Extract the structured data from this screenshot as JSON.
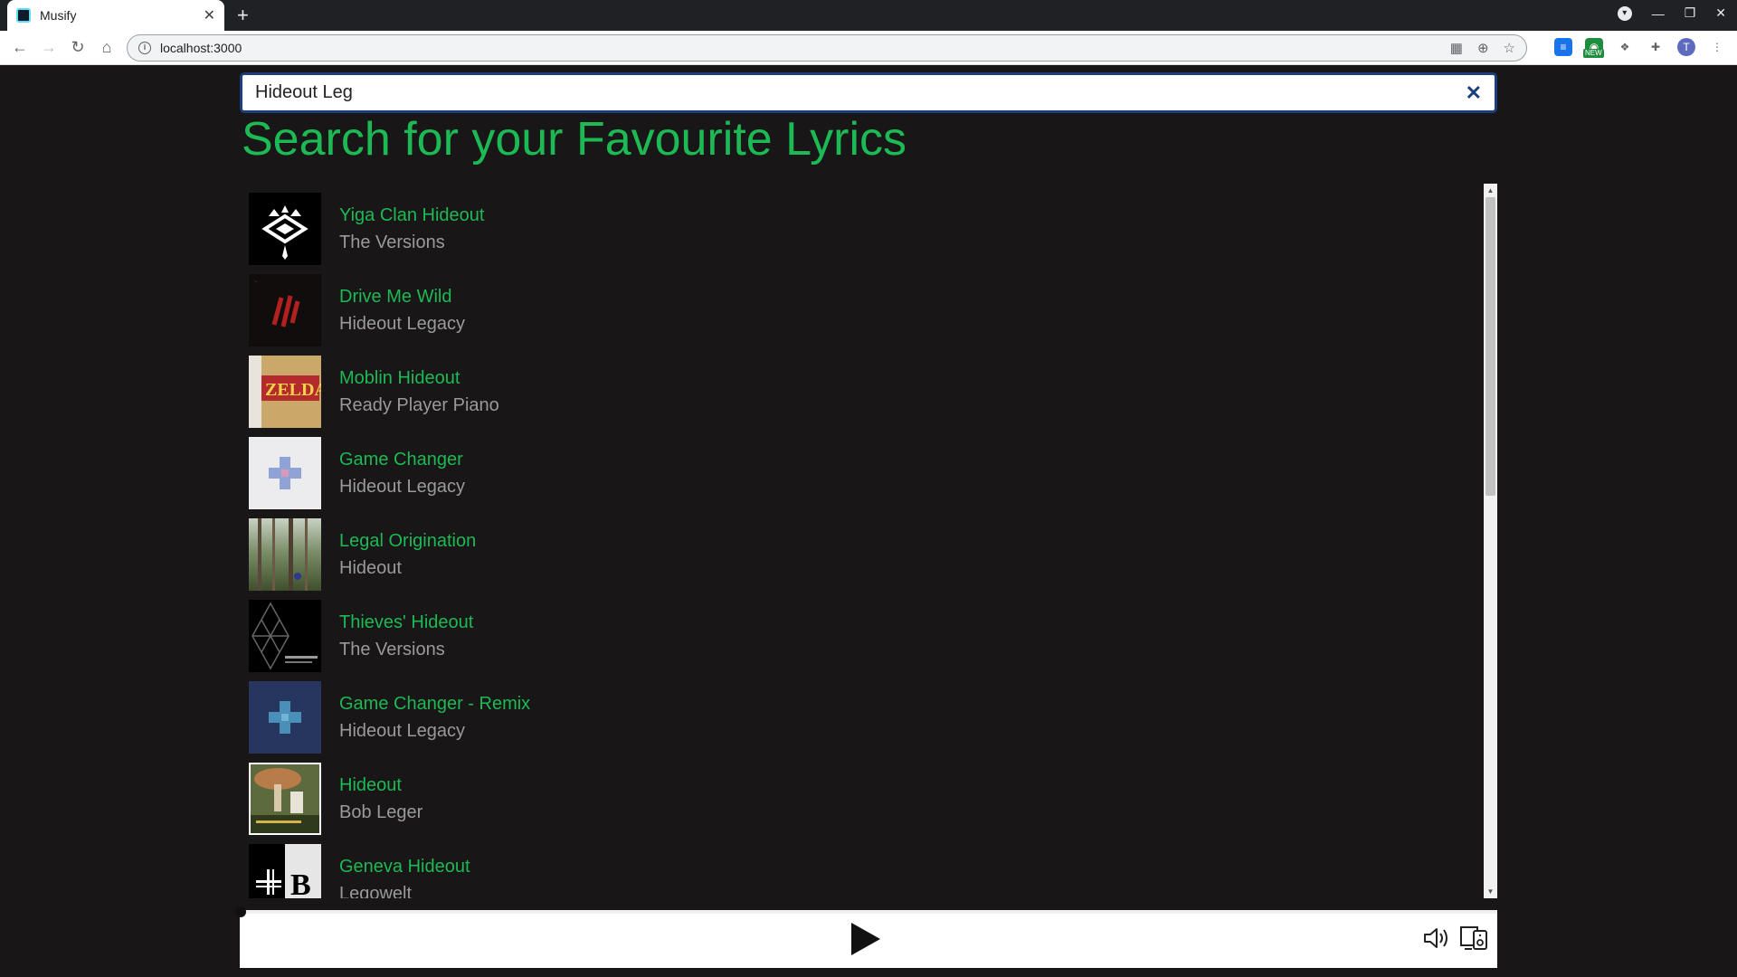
{
  "browser": {
    "tab_title": "Musify",
    "url": "localhost:3000",
    "new_badge": "NEW",
    "avatar_letter": "T"
  },
  "search": {
    "value": "Hideout Leg",
    "clear_icon": "close-icon"
  },
  "heading": "Search for your Favourite Lyrics",
  "colors": {
    "accent": "#1db954",
    "artist": "#9a9a9a",
    "background": "#181616",
    "search_border": "#1c3f7a"
  },
  "results": [
    {
      "title": "Yiga Clan Hideout",
      "artist": "The Versions"
    },
    {
      "title": "Drive Me Wild",
      "artist": "Hideout Legacy"
    },
    {
      "title": "Moblin Hideout",
      "artist": "Ready Player Piano"
    },
    {
      "title": "Game Changer",
      "artist": "Hideout Legacy"
    },
    {
      "title": "Legal Origination",
      "artist": "Hideout"
    },
    {
      "title": "Thieves' Hideout",
      "artist": "The Versions"
    },
    {
      "title": "Game Changer - Remix",
      "artist": "Hideout Legacy"
    },
    {
      "title": "Hideout",
      "artist": "Bob Leger"
    },
    {
      "title": "Geneva Hideout",
      "artist": "Legowelt"
    }
  ],
  "player": {
    "progress": 0,
    "play_icon": "play-icon",
    "volume_icon": "volume-icon",
    "device_icon": "device-icon"
  }
}
